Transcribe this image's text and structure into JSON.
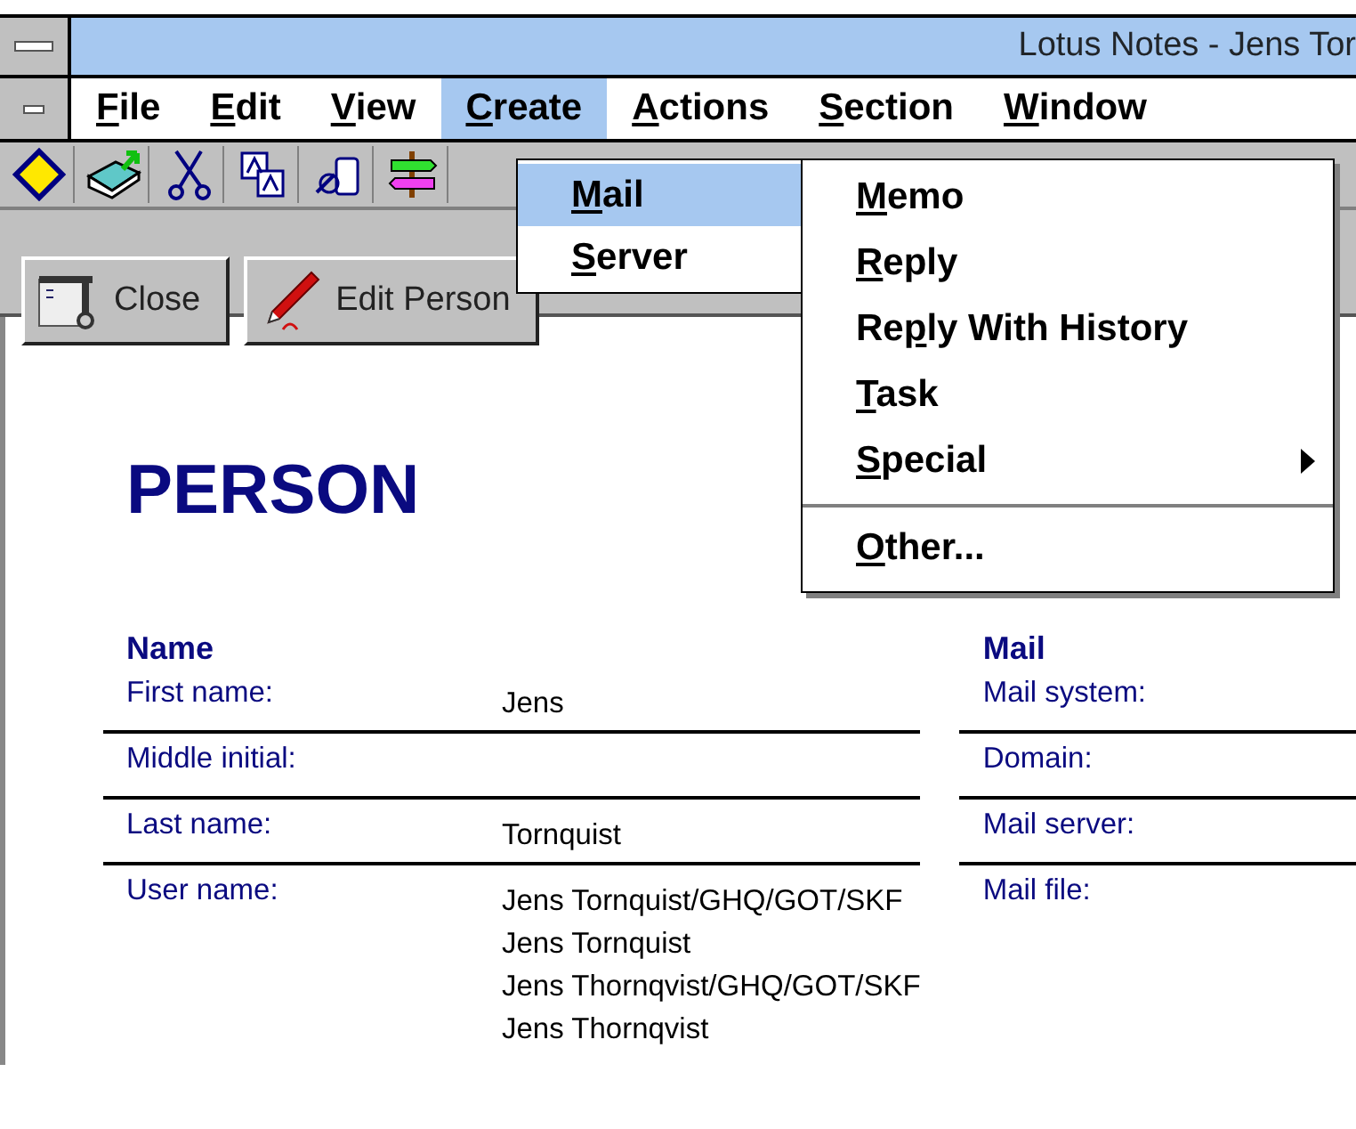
{
  "window": {
    "title": "Lotus Notes - Jens Tor"
  },
  "menu_bar": [
    {
      "key": "F",
      "rest": "ile",
      "selected": false
    },
    {
      "key": "E",
      "rest": "dit",
      "selected": false
    },
    {
      "key": "V",
      "rest": "iew",
      "selected": false
    },
    {
      "key": "C",
      "rest": "reate",
      "selected": true
    },
    {
      "key": "A",
      "rest": "ctions",
      "selected": false
    },
    {
      "key": "S",
      "rest": "ection",
      "selected": false
    },
    {
      "key": "W",
      "rest": "indow",
      "selected": false
    }
  ],
  "create_menu": [
    {
      "key": "M",
      "rest": "ail",
      "selected": true
    },
    {
      "key": "S",
      "rest": "erver",
      "selected": false
    }
  ],
  "mail_submenu": [
    {
      "key": "M",
      "rest": "emo",
      "kind": "item"
    },
    {
      "key": "R",
      "rest": "eply",
      "kind": "item"
    },
    {
      "lead": "Re",
      "key": "p",
      "rest": "ly With History",
      "kind": "item"
    },
    {
      "key": "T",
      "rest": "ask",
      "kind": "item"
    },
    {
      "key": "S",
      "rest": "pecial",
      "kind": "submenu"
    },
    {
      "key": "O",
      "rest": "ther...",
      "kind": "item"
    }
  ],
  "action_buttons": [
    {
      "label": "Close",
      "kind": "close"
    },
    {
      "label": "Edit Person",
      "kind": "edit"
    }
  ],
  "form": {
    "title": "PERSON",
    "name_section": {
      "heading": "Name",
      "fields": [
        {
          "label": "First name:",
          "values": [
            "Jens"
          ]
        },
        {
          "label": "Middle initial:"
        },
        {
          "label": "Last name:",
          "values": [
            "Tornquist"
          ]
        },
        {
          "label": "User name:",
          "values": [
            "Jens Tornquist/GHQ/GOT/SKF",
            "Jens Tornquist",
            "Jens Thornqvist/GHQ/GOT/SKF",
            "Jens Thornqvist"
          ]
        }
      ]
    },
    "mail_section": {
      "heading": "Mail",
      "fields": [
        {
          "label": "Mail system:"
        },
        {
          "label": "Domain:"
        },
        {
          "label": "Mail server:"
        },
        {
          "label": "Mail file:"
        }
      ]
    }
  }
}
